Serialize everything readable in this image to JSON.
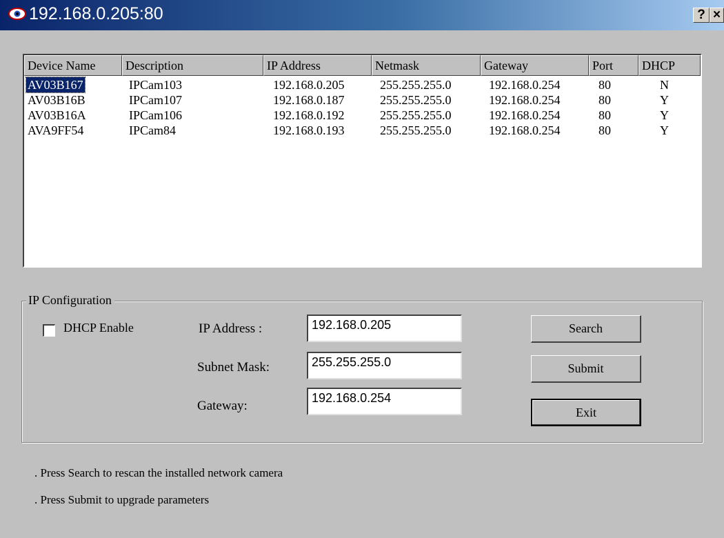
{
  "window": {
    "title": "192.168.0.205:80",
    "help_label": "?",
    "close_label": "×"
  },
  "device_list": {
    "columns": [
      "Device Name",
      "Description",
      "IP Address",
      "Netmask",
      "Gateway",
      "Port",
      "DHCP"
    ],
    "rows": [
      [
        "AV03B167",
        "IPCam103",
        "192.168.0.205",
        "255.255.255.0",
        "192.168.0.254",
        "80",
        "N"
      ],
      [
        "AV03B16B",
        "IPCam107",
        "192.168.0.187",
        "255.255.255.0",
        "192.168.0.254",
        "80",
        "Y"
      ],
      [
        "AV03B16A",
        "IPCam106",
        "192.168.0.192",
        "255.255.255.0",
        "192.168.0.254",
        "80",
        "Y"
      ],
      [
        "AVA9FF54",
        "IPCam84",
        "192.168.0.193",
        "255.255.255.0",
        "192.168.0.254",
        "80",
        "Y"
      ]
    ],
    "selected_row": 0
  },
  "ip_config": {
    "group_label": "IP Configuration",
    "dhcp_label": "DHCP Enable",
    "dhcp_checked": false,
    "ip_label": "IP Address :",
    "ip_value": "192.168.0.205",
    "mask_label": "Subnet Mask:",
    "mask_value": "255.255.255.0",
    "gateway_label": "Gateway:",
    "gateway_value": "192.168.0.254"
  },
  "buttons": {
    "search": "Search",
    "submit": "Submit",
    "exit": "Exit"
  },
  "hints": {
    "search_hint": ". Press Search to rescan the installed network camera",
    "submit_hint": ". Press Submit to upgrade parameters"
  },
  "colors": {
    "title_gradient_start": "#0a246a",
    "title_gradient_end": "#a6caf0",
    "selection": "#0a246a",
    "face": "#c0c0c0"
  }
}
